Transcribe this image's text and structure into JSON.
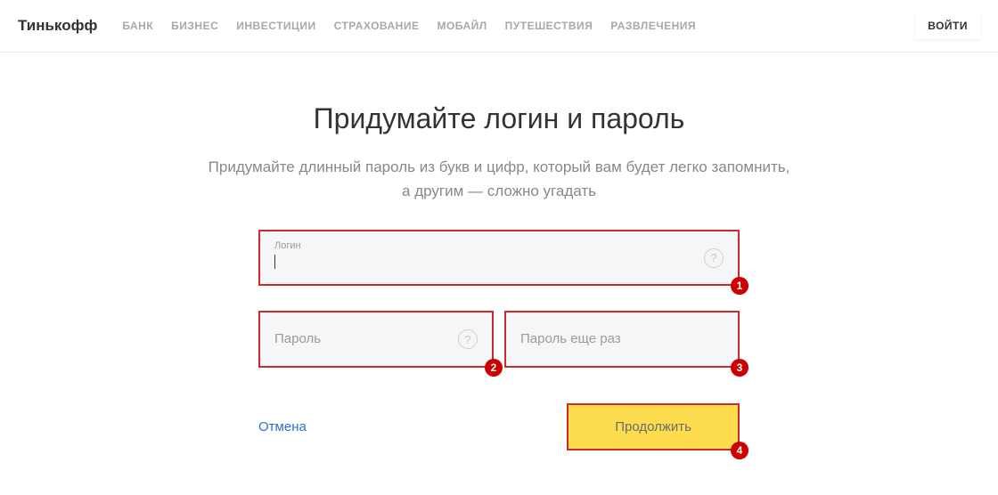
{
  "header": {
    "logo": "Тинькофф",
    "nav": [
      "БАНК",
      "БИЗНЕС",
      "ИНВЕСТИЦИИ",
      "СТРАХОВАНИЕ",
      "МОБАЙЛ",
      "ПУТЕШЕСТВИЯ",
      "РАЗВЛЕЧЕНИЯ"
    ],
    "login": "ВОЙТИ"
  },
  "main": {
    "title": "Придумайте логин и пароль",
    "subtitle_line1": "Придумайте длинный пароль из букв и цифр, который вам будет легко запомнить,",
    "subtitle_line2": "а другим — сложно угадать"
  },
  "form": {
    "login": {
      "label": "Логин",
      "value": "",
      "help": "?"
    },
    "password": {
      "placeholder": "Пароль",
      "help": "?"
    },
    "password_repeat": {
      "placeholder": "Пароль еще раз"
    },
    "cancel": "Отмена",
    "continue": "Продолжить"
  },
  "markers": {
    "m1": "1",
    "m2": "2",
    "m3": "3",
    "m4": "4"
  }
}
